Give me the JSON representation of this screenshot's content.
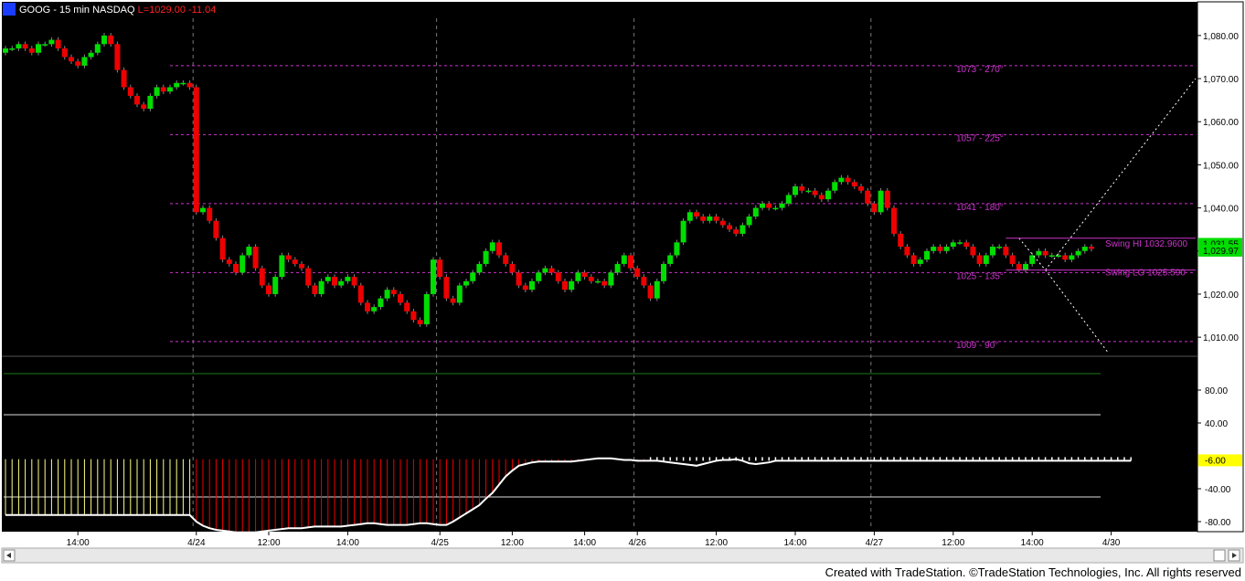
{
  "header": {
    "symbol": "GOOG",
    "interval": "15 min",
    "exchange": "NASDAQ",
    "last_label": "L=1029.00",
    "change": "-11.04"
  },
  "colors": {
    "background": "#000000",
    "up_bar": "#00dd00",
    "down_bar": "#ee0000",
    "gann_line": "#cc33cc",
    "price_tag": "#00dd00",
    "indicator_tag": "#ffff00",
    "oscillator_line": "#ffffff",
    "trendline": "#ffffff"
  },
  "chart_data": [
    {
      "type": "candlestick",
      "title": "GOOG - 15 min",
      "ylim": [
        1006,
        1084
      ],
      "y_ticks": [
        "1,080.00",
        "1,070.00",
        "1,060.00",
        "1,050.00",
        "1,040.00",
        "1,030.00",
        "1,020.00",
        "1,010.00"
      ],
      "x_ticks": [
        "14:00",
        "4/24",
        "12:00",
        "14:00",
        "4/25",
        "12:00",
        "14:00",
        "4/26",
        "12:00",
        "14:00",
        "4/27",
        "12:00",
        "14:00",
        "4/30"
      ],
      "session_breaks": [
        "4/24",
        "4/25",
        "4/26",
        "4/27"
      ],
      "levels": [
        {
          "price": 1073,
          "label": "1073 - 270°"
        },
        {
          "price": 1057,
          "label": "1057 - 225°"
        },
        {
          "price": 1041,
          "label": "1041 - 180°"
        },
        {
          "price": 1025,
          "label": "1025 - 135°"
        },
        {
          "price": 1009,
          "label": "1009 - 90°"
        }
      ],
      "swing_hi": {
        "price": 1032.96,
        "label": "Swing HI 1032.9600"
      },
      "swing_lo": {
        "price": 1025.59,
        "label": "Swing LO 1025.590"
      },
      "price_tags": [
        "1,031.55",
        "1,029.97"
      ],
      "close_series": [
        1077,
        1077,
        1078,
        1077,
        1076,
        1078,
        1078,
        1079,
        1077,
        1075,
        1074,
        1073,
        1075,
        1076,
        1078,
        1080,
        1078,
        1072,
        1068,
        1066,
        1064,
        1063,
        1066,
        1068,
        1067,
        1068,
        1069,
        1069,
        1068,
        1039,
        1040,
        1037,
        1033,
        1028,
        1027,
        1025,
        1029,
        1031,
        1026,
        1022,
        1020,
        1024,
        1029,
        1028,
        1027,
        1026,
        1022,
        1020,
        1023,
        1024,
        1022,
        1023,
        1024,
        1022,
        1018,
        1016,
        1017,
        1019,
        1021,
        1020,
        1018,
        1016,
        1014,
        1013,
        1020,
        1028,
        1024,
        1019,
        1018,
        1022,
        1023,
        1025,
        1027,
        1030,
        1032,
        1029,
        1027,
        1025,
        1022,
        1021,
        1023,
        1025,
        1026,
        1025,
        1023,
        1021,
        1023,
        1025,
        1024,
        1023,
        1023,
        1022,
        1025,
        1027,
        1029,
        1026,
        1024,
        1022,
        1019,
        1023,
        1027,
        1029,
        1032,
        1037,
        1039,
        1038,
        1037,
        1038,
        1037,
        1036,
        1035,
        1034,
        1036,
        1038,
        1040,
        1041,
        1040,
        1040,
        1041,
        1043,
        1045,
        1044,
        1044,
        1043,
        1042,
        1044,
        1046,
        1047,
        1046,
        1045,
        1044,
        1041,
        1039,
        1044,
        1040,
        1034,
        1031,
        1029,
        1027,
        1028,
        1030,
        1031,
        1030,
        1031,
        1032,
        1032,
        1031,
        1029,
        1027,
        1029,
        1031,
        1031,
        1029,
        1027,
        1025.6,
        1027,
        1029,
        1030,
        1029,
        1029,
        1029,
        1028,
        1029,
        1030,
        1031,
        1030.5
      ],
      "series_name": "GOOG"
    },
    {
      "type": "line",
      "ylim": [
        -90,
        110
      ],
      "y_ticks": [
        "80.00",
        "40.00",
        "-40.00",
        "-80.00"
      ],
      "current_value_label": "-6.00",
      "levels": [
        100,
        50,
        -50
      ],
      "values": [
        -72,
        -72,
        -72,
        -72,
        -72,
        -72,
        -72,
        -72,
        -72,
        -72,
        -72,
        -72,
        -72,
        -72,
        -72,
        -72,
        -72,
        -72,
        -72,
        -72,
        -72,
        -72,
        -72,
        -72,
        -72,
        -72,
        -72,
        -72,
        -72,
        -80,
        -85,
        -88,
        -90,
        -91,
        -92,
        -93,
        -93,
        -93,
        -93,
        -92,
        -91,
        -90,
        -89,
        -88,
        -88,
        -88,
        -87,
        -86,
        -86,
        -86,
        -86,
        -86,
        -85,
        -84,
        -83,
        -82,
        -82,
        -83,
        -84,
        -84,
        -84,
        -84,
        -83,
        -82,
        -82,
        -83,
        -84,
        -84,
        -80,
        -75,
        -70,
        -65,
        -60,
        -52,
        -45,
        -35,
        -25,
        -18,
        -12,
        -10,
        -8,
        -7,
        -7,
        -7,
        -7,
        -7,
        -7,
        -6,
        -5,
        -4,
        -3,
        -3,
        -3,
        -4,
        -5,
        -5,
        -6,
        -6,
        -6,
        -6,
        -7,
        -8,
        -9,
        -10,
        -11,
        -12,
        -10,
        -8,
        -6,
        -5,
        -5,
        -4,
        -6,
        -9,
        -10,
        -9,
        -8,
        -6,
        -6,
        -6,
        -6,
        -6,
        -6,
        -6,
        -6,
        -6,
        -6,
        -6,
        -6,
        -6,
        -6,
        -6,
        -6,
        -6,
        -6,
        -6,
        -6,
        -6,
        -6,
        -6,
        -6,
        -6,
        -6,
        -6,
        -6,
        -6,
        -6,
        -6,
        -6,
        -6,
        -6,
        -6,
        -6,
        -6,
        -6,
        -6,
        -6,
        -6,
        -6,
        -6,
        -6,
        -6,
        -6,
        -6,
        -6,
        -6,
        -6,
        -6,
        -6,
        -6,
        -6,
        -6
      ]
    }
  ],
  "footer": {
    "credit": "Created with TradeStation. ©TradeStation Technologies, Inc. All rights reserved"
  }
}
